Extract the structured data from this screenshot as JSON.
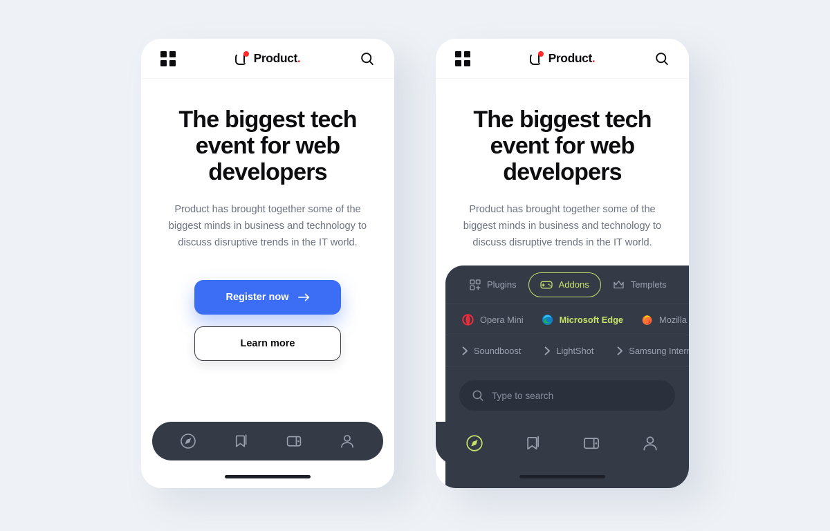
{
  "background_color": "#eef2f6",
  "brand": {
    "name": "Product",
    "period": ".",
    "logo_icon": "c-mark-with-red-dot",
    "accent_red": "#ff2b2b"
  },
  "appbar": {
    "menu_icon": "grid-menu-icon",
    "search_icon": "search-icon"
  },
  "hero": {
    "heading": "The biggest tech event for web developers",
    "paragraph": "Product has brought together some of the biggest minds in business and technology to discuss disruptive trends in the IT world.",
    "primary_button": {
      "label": "Register now",
      "icon": "arrow-right-icon",
      "color": "#3b6ef5"
    },
    "secondary_button": {
      "label": "Learn more"
    }
  },
  "tabbar": {
    "background": "#343a46",
    "active_color": "#c9e26b",
    "items": [
      {
        "name": "explore",
        "icon": "compass-icon",
        "active_on_right_phone": true
      },
      {
        "name": "bookmarks",
        "icon": "bookmark-icon",
        "active_on_right_phone": false
      },
      {
        "name": "wallet",
        "icon": "wallet-icon",
        "active_on_right_phone": false
      },
      {
        "name": "profile",
        "icon": "person-icon",
        "active_on_right_phone": false
      }
    ]
  },
  "panel": {
    "background": "#343a46",
    "accent": "#c9e26b",
    "categories": [
      {
        "label": "Plugins",
        "icon": "plugins-grid-icon",
        "active": false
      },
      {
        "label": "Addons",
        "icon": "gamepad-icon",
        "active": true
      },
      {
        "label": "Templets",
        "icon": "crown-icon",
        "active": false
      },
      {
        "label": "",
        "icon": "cookie-icon",
        "active": false
      }
    ],
    "browsers": [
      {
        "label": "Opera Mini",
        "icon": "opera-icon",
        "active": false,
        "color": "#ee2b3a"
      },
      {
        "label": "Microsoft Edge",
        "icon": "edge-icon",
        "active": true,
        "color": "#0f7ec4"
      },
      {
        "label": "Mozilla Firefox",
        "icon": "firefox-icon",
        "active": false,
        "color": "#ff7139"
      }
    ],
    "links": [
      {
        "label": "Soundboost",
        "icon": "chevron-right-icon"
      },
      {
        "label": "LightShot",
        "icon": "chevron-right-icon"
      },
      {
        "label": "Samsung Internet",
        "icon": "chevron-right-icon"
      }
    ],
    "search": {
      "placeholder": "Type to search",
      "icon": "search-icon"
    }
  }
}
